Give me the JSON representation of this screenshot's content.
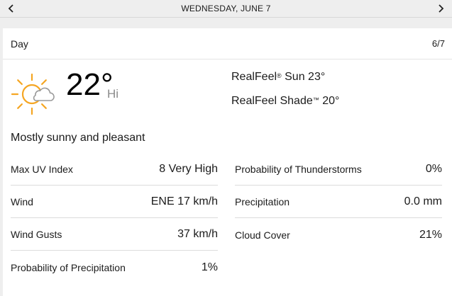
{
  "nav": {
    "date_label": "WEDNESDAY, JUNE 7",
    "prev_icon": "chevron-left-icon",
    "next_icon": "chevron-right-icon"
  },
  "card": {
    "period": "Day",
    "date_short": "6/7",
    "weather_icon": "mostly-sunny-icon",
    "temperature": "22°",
    "temp_qualifier": "Hi",
    "realfeel_label": "RealFeel",
    "realfeel_mark": "®",
    "realfeel_value": "Sun 23°",
    "realfeel_shade_label": "RealFeel Shade",
    "realfeel_shade_mark": "™",
    "realfeel_shade_value": "20°",
    "phrase": "Mostly sunny and pleasant",
    "left_details": [
      {
        "label": "Max UV Index",
        "value": "8 Very High"
      },
      {
        "label": "Wind",
        "value": "ENE 17 km/h"
      },
      {
        "label": "Wind Gusts",
        "value": "37 km/h"
      },
      {
        "label": "Probability of Precipitation",
        "value": "1%"
      }
    ],
    "right_details": [
      {
        "label": "Probability of Thunderstorms",
        "value": "0%"
      },
      {
        "label": "Precipitation",
        "value": "0.0 mm"
      },
      {
        "label": "Cloud Cover",
        "value": "21%"
      }
    ]
  },
  "colors": {
    "sun": "#f5a623",
    "cloud_stroke": "#9a9a9a",
    "page_bg": "#eeeeee",
    "card_bg": "#ffffff"
  }
}
